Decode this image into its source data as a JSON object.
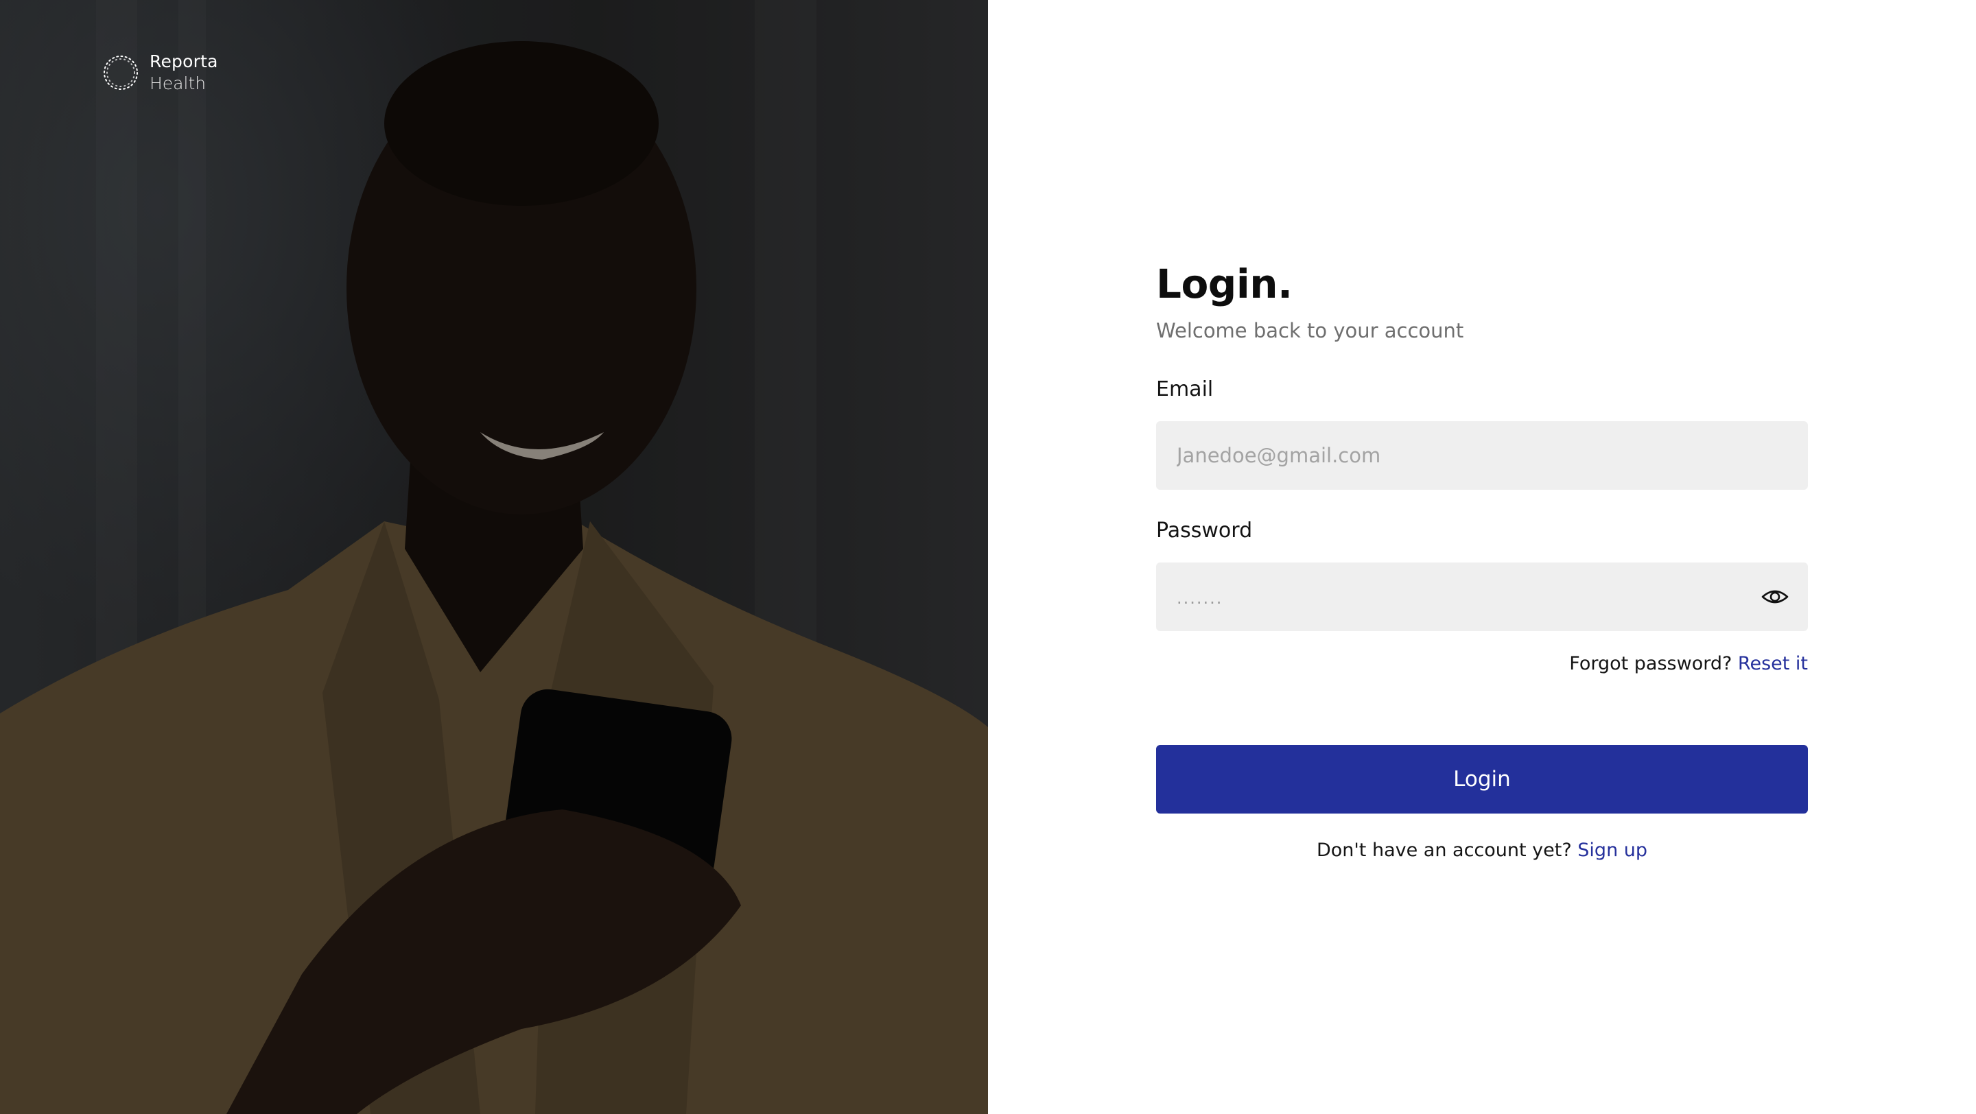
{
  "brand": {
    "name_line1": "Reporta",
    "name_line2": "Health",
    "logo_icon": "dotted-ring-logo"
  },
  "hero": {
    "image": "smiling man in camel coat looking at phone"
  },
  "form": {
    "title": "Login.",
    "subtitle": "Welcome back to your account",
    "email": {
      "label": "Email",
      "placeholder": "Janedoe@gmail.com",
      "value": ""
    },
    "password": {
      "label": "Password",
      "masked_value": ".......",
      "toggle_icon": "eye-icon"
    },
    "forgot": {
      "text": "Forgot password?",
      "link": "Reset it"
    },
    "submit_label": "Login",
    "signup": {
      "text": "Don't have an account yet?",
      "link": "Sign up"
    }
  },
  "colors": {
    "primary": "#23309b",
    "link": "#26319c",
    "input_bg": "#efefef",
    "placeholder": "#a3a3a3",
    "subtitle": "#6f6f6f"
  }
}
